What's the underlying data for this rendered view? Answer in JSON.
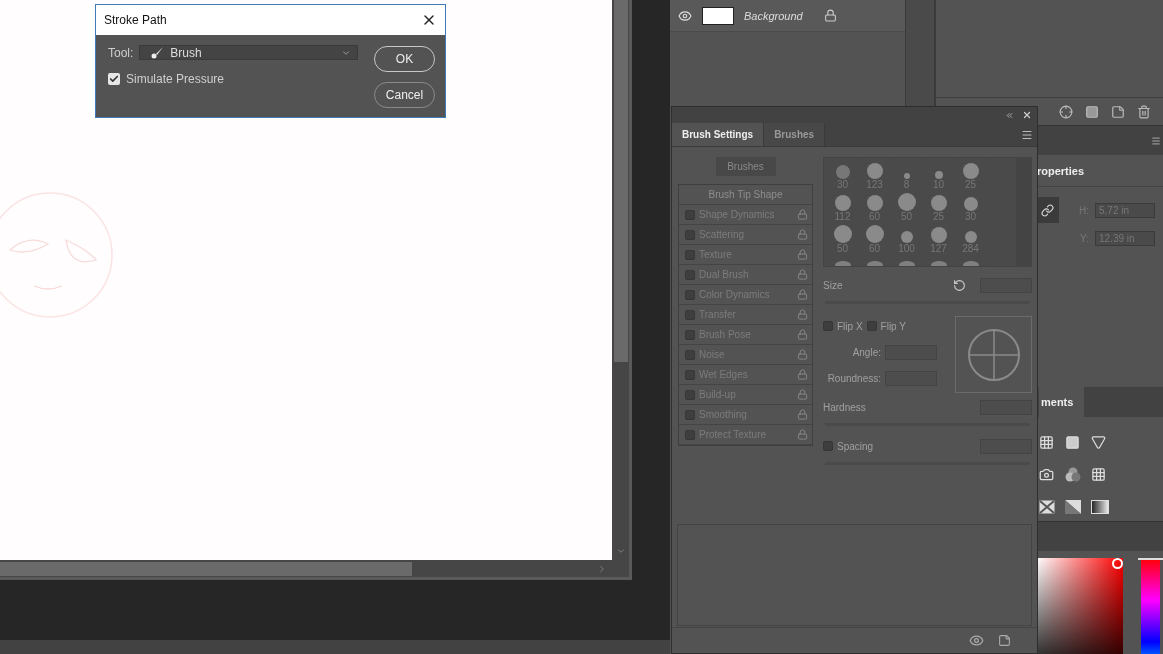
{
  "dialog": {
    "title": "Stroke Path",
    "tool_label": "Tool:",
    "tool_value": "Brush",
    "simulate_pressure": {
      "label": "Simulate Pressure",
      "checked": true
    },
    "buttons": [
      "OK",
      "Cancel"
    ]
  },
  "layers": [
    {
      "name": "Background",
      "visible": true,
      "locked": true
    }
  ],
  "brush_panel": {
    "tabs": [
      {
        "label": "Brush Settings",
        "selected": true
      },
      {
        "label": "Brushes",
        "selected": false
      }
    ],
    "brushes_button": "Brushes",
    "tip_shape_label": "Brush Tip Shape",
    "options": [
      {
        "label": "Shape Dynamics",
        "checked": false
      },
      {
        "label": "Scattering",
        "checked": false
      },
      {
        "label": "Texture",
        "checked": false
      },
      {
        "label": "Dual Brush",
        "checked": false
      },
      {
        "label": "Color Dynamics",
        "checked": false
      },
      {
        "label": "Transfer",
        "checked": false
      },
      {
        "label": "Brush Pose",
        "checked": false
      },
      {
        "label": "Noise",
        "checked": false
      },
      {
        "label": "Wet Edges",
        "checked": false
      },
      {
        "label": "Build-up",
        "checked": false
      },
      {
        "label": "Smoothing",
        "checked": false
      },
      {
        "label": "Protect Texture",
        "checked": false
      }
    ],
    "presets": [
      "30",
      "123",
      "8",
      "10",
      "25",
      "112",
      "60",
      "50",
      "25",
      "30",
      "50",
      "60",
      "100",
      "127",
      "284"
    ],
    "size_label": "Size",
    "flip_x": {
      "label": "Flip X",
      "checked": false
    },
    "flip_y": {
      "label": "Flip Y",
      "checked": false
    },
    "angle_label": "Angle:",
    "roundness_label": "Roundness:",
    "hardness_label": "Hardness",
    "spacing": {
      "label": "Spacing",
      "checked": false
    }
  },
  "properties": {
    "title": "roperties",
    "h_label": "H:",
    "h_value": "5.72 in",
    "y_label": "Y:",
    "y_value": "12.39 in"
  },
  "adjustments": {
    "title": "ments"
  },
  "color": {
    "hue": {
      "level": 1
    }
  }
}
